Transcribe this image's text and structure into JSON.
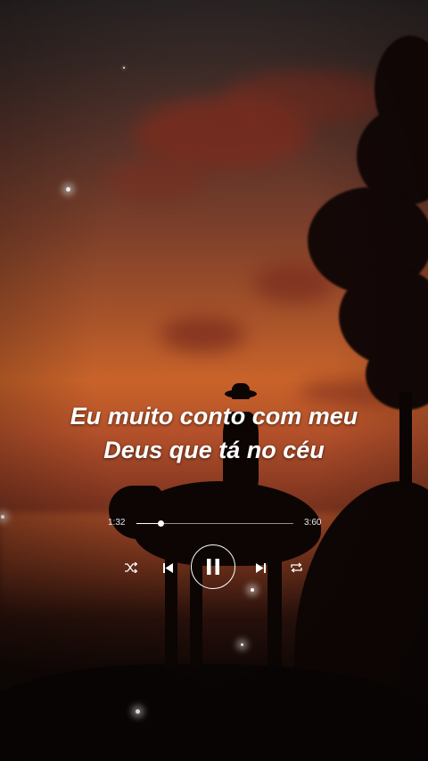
{
  "lyrics": {
    "line1": "Eu muito conto com meu",
    "line2": "Deus que tá no céu"
  },
  "player": {
    "elapsed": "1:32",
    "duration": "3:60",
    "progress": 0.155,
    "state": "playing"
  },
  "icons": {
    "shuffle": "shuffle-icon",
    "previous": "skip-previous-icon",
    "pause": "pause-icon",
    "next": "skip-next-icon",
    "repeat": "repeat-icon"
  },
  "colors": {
    "text": "#ffffff",
    "sky_top": "#2c2626",
    "sunset": "#c9632a",
    "ground": "#0a0504"
  }
}
